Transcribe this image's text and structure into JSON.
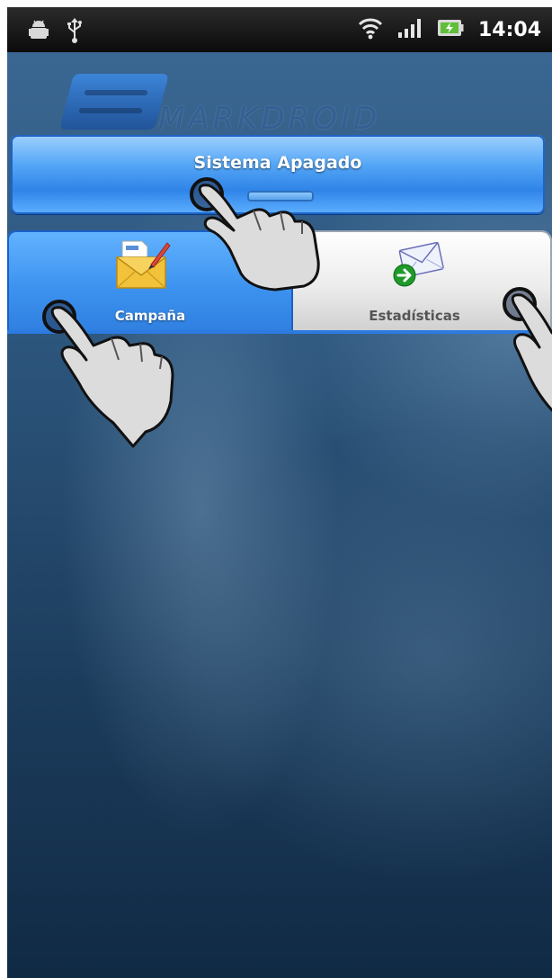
{
  "status_bar": {
    "left_icons": [
      "android-notification-icon",
      "usb-icon"
    ],
    "right_icons": [
      "wifi-icon",
      "signal-icon",
      "battery-charging-icon"
    ],
    "time": "14:04"
  },
  "header": {
    "logo_text": "MARKDROID"
  },
  "system_button": {
    "label": "Sistema Apagado",
    "indicator_state": "off"
  },
  "tabs": [
    {
      "label": "Campaña",
      "icon": "envelope-edit-icon",
      "selected": true
    },
    {
      "label": "Estadísticas",
      "icon": "envelope-send-icon",
      "selected": false
    }
  ],
  "overlays": {
    "tap_hint_icons": [
      "hand-tap-icon",
      "hand-tap-icon",
      "hand-tap-icon"
    ]
  },
  "colors": {
    "accent_blue": "#3d93ef",
    "status_bar_bg": "#0b0b0b",
    "background_dark": "#1c3c5c"
  }
}
